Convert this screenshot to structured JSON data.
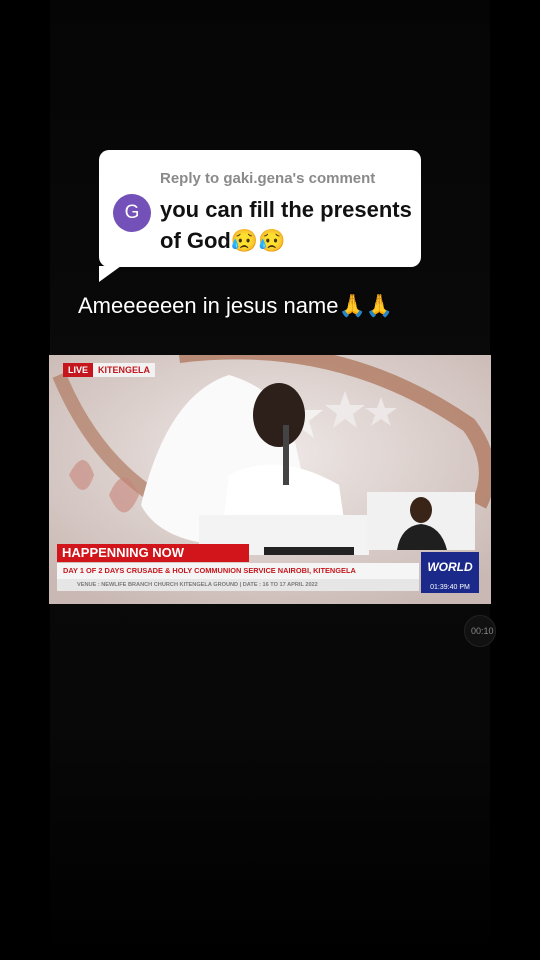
{
  "reply": {
    "header": "Reply to gaki.gena's comment",
    "avatar_initial": "G",
    "comment": "you can fill the presents of God😥😥"
  },
  "caption": "Ameeeeeen in jesus name🙏🙏",
  "video": {
    "live_label": "LIVE",
    "location": "KITENGELA",
    "ticker_title": "HAPPENNING NOW",
    "ticker_main": "DAY 1 OF 2 DAYS CRUSADE & HOLY COMMUNION SERVICE NAIROBI, KITENGELA",
    "ticker_sub": "VENUE : NEWLIFE BRANCH CHURCH KITENGELA GROUND | DATE : 16 TO 17 APRIL 2022",
    "channel": "WORLD",
    "channel_time": "01:39:40 PM"
  },
  "timestamp": "00:10",
  "colors": {
    "avatar": "#7451b8",
    "ticker_red": "#d2151a",
    "channel_blue": "#1b2a8a"
  }
}
